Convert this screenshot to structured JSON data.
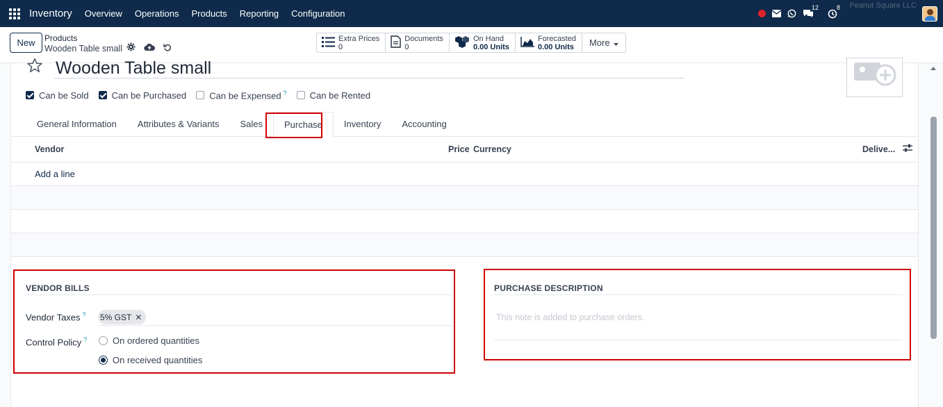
{
  "navbar": {
    "app_name": "Inventory",
    "menu": [
      "Overview",
      "Operations",
      "Products",
      "Reporting",
      "Configuration"
    ],
    "messages_count": "12",
    "activities_count": "8",
    "company": "Peanut Square LLC"
  },
  "control_panel": {
    "new_label": "New",
    "breadcrumb": "Products",
    "record_name": "Wooden Table small",
    "smart_buttons": [
      {
        "label": "Extra Prices",
        "value": "0"
      },
      {
        "label": "Documents",
        "value": "0"
      },
      {
        "label": "On Hand",
        "value": "0.00 Units"
      },
      {
        "label": "Forecasted",
        "value": "0.00 Units"
      }
    ],
    "more_label": "More"
  },
  "product": {
    "name": "Wooden Table small",
    "flags": [
      {
        "label": "Can be Sold",
        "checked": true,
        "help": false
      },
      {
        "label": "Can be Purchased",
        "checked": true,
        "help": false
      },
      {
        "label": "Can be Expensed",
        "checked": false,
        "help": true
      },
      {
        "label": "Can be Rented",
        "checked": false,
        "help": false
      }
    ]
  },
  "tabs": [
    "General Information",
    "Attributes & Variants",
    "Sales",
    "Purchase",
    "Inventory",
    "Accounting"
  ],
  "active_tab": "Purchase",
  "vendor_list": {
    "columns": {
      "vendor": "Vendor",
      "price": "Price",
      "currency": "Currency",
      "delivery": "Delive..."
    },
    "add_line": "Add a line"
  },
  "vendor_bills": {
    "title": "VENDOR BILLS",
    "vendor_taxes_label": "Vendor Taxes",
    "vendor_taxes": [
      "5% GST"
    ],
    "control_policy_label": "Control Policy",
    "control_policy_options": [
      {
        "label": "On ordered quantities",
        "selected": false
      },
      {
        "label": "On received quantities",
        "selected": true
      }
    ]
  },
  "purchase_description": {
    "title": "PURCHASE DESCRIPTION",
    "placeholder": "This note is added to purchase orders."
  },
  "help_mark": "?",
  "colors": {
    "navbar": "#0f2a4a",
    "highlight": "#d10000",
    "accent": "#0f2a4a"
  }
}
